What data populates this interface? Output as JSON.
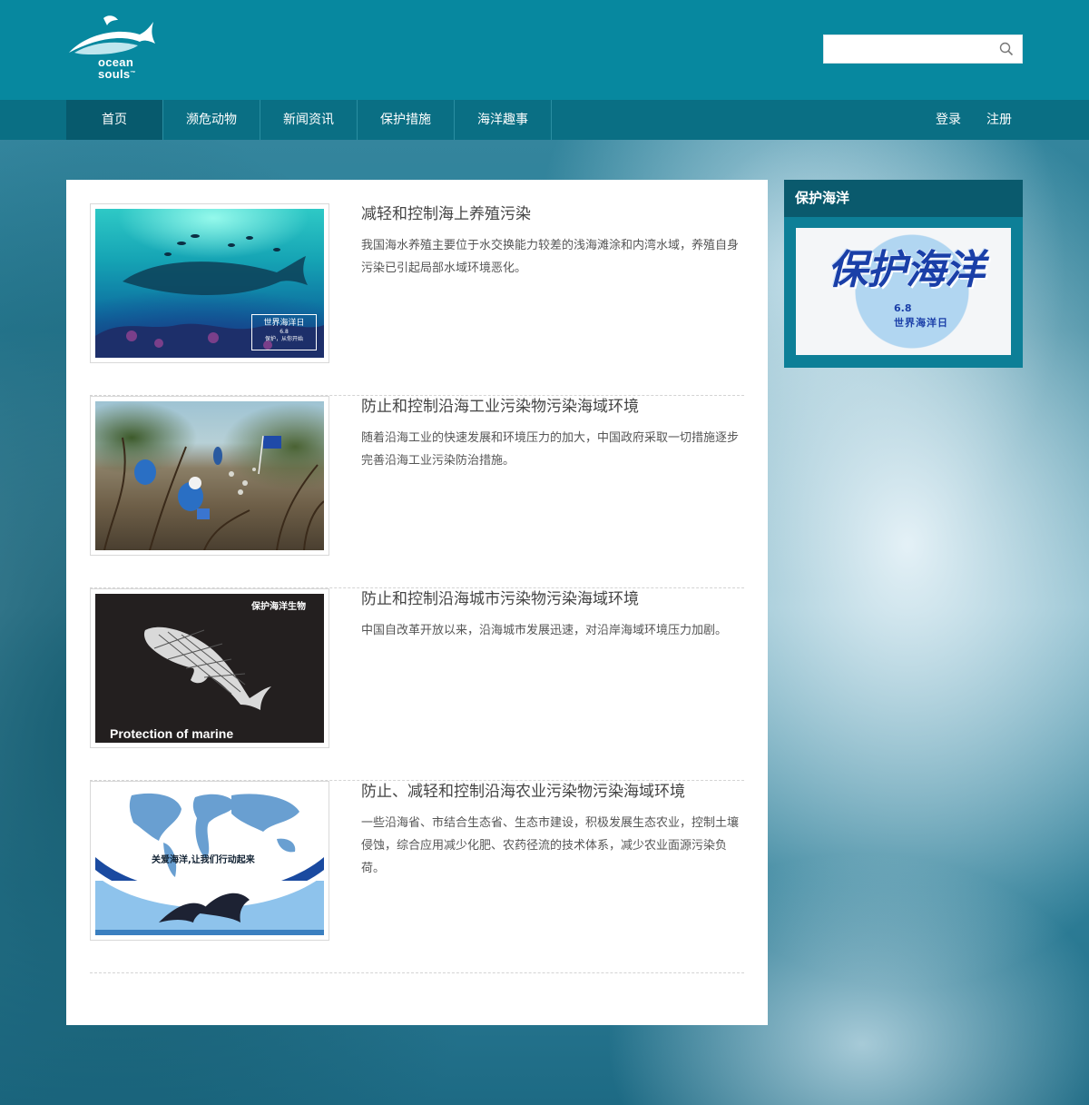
{
  "brand": {
    "line1": "ocean",
    "line2": "souls",
    "tm": "™"
  },
  "search": {
    "value": "",
    "placeholder": ""
  },
  "nav": {
    "items": [
      "首页",
      "濒危动物",
      "新闻资讯",
      "保护措施",
      "海洋趣事"
    ],
    "active_index": 0,
    "login": "登录",
    "register": "注册"
  },
  "articles": [
    {
      "title": "减轻和控制海上养殖污染",
      "desc": "我国海水养殖主要位于水交换能力较差的浅海滩涂和内湾水域，养殖自身污染已引起局部水域环境恶化。",
      "thumb_text": [
        "世界海洋日",
        "6.8",
        "保护，从你开始"
      ]
    },
    {
      "title": "防止和控制沿海工业污染物污染海域环境",
      "desc": "随着沿海工业的快速发展和环境压力的加大，中国政府采取一切措施逐步完善沿海工业污染防治措施。"
    },
    {
      "title": "防止和控制沿海城市污染物污染海域环境",
      "desc": "中国自改革开放以来，沿海城市发展迅速，对沿岸海域环境压力加剧。",
      "thumb_text": [
        "保护海洋生物",
        "Protection of marine"
      ]
    },
    {
      "title": "防止、减轻和控制沿海农业污染物污染海域环境",
      "desc": "一些沿海省、市结合生态省、生态市建设，积极发展生态农业，控制土壤侵蚀，综合应用减少化肥、农药径流的技术体系，减少农业面源污染负荷。",
      "thumb_text": [
        "关爱海洋,让我们行动起来"
      ]
    }
  ],
  "sidebar": {
    "title": "保护海洋",
    "banner_title": "保护海洋",
    "banner_date": "6.8",
    "banner_sub": "世界海洋日"
  },
  "colors": {
    "header_bg": "#07889f",
    "nav_bg": "#0a6f84",
    "nav_active": "#075a6d",
    "sidebar_head": "#0a5a6d"
  }
}
